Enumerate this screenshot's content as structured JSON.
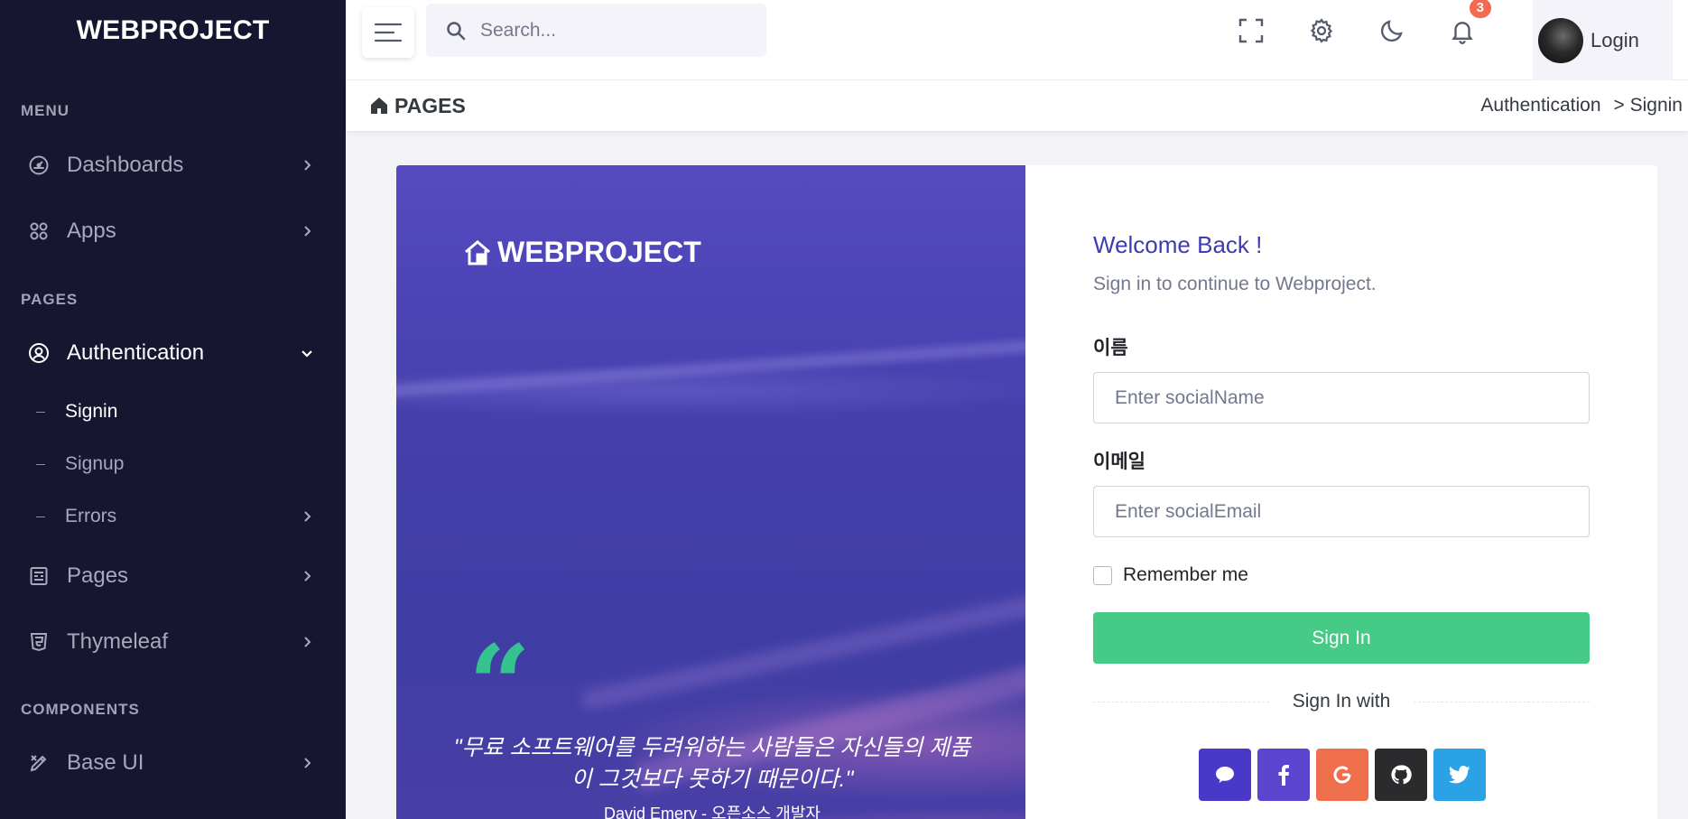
{
  "brand": "WEBPROJECT",
  "sidebar": {
    "menu_title": "MENU",
    "pages_title": "PAGES",
    "components_title": "COMPONENTS",
    "items": {
      "dashboards": "Dashboards",
      "apps": "Apps",
      "authentication": "Authentication",
      "signin": "Signin",
      "signup": "Signup",
      "errors": "Errors",
      "pages": "Pages",
      "thymeleaf": "Thymeleaf",
      "base_ui": "Base UI"
    }
  },
  "topbar": {
    "search_placeholder": "Search...",
    "notification_count": "3",
    "user_label": "Login"
  },
  "titlebar": {
    "title": "PAGES",
    "breadcrumb_parent": "Authentication",
    "breadcrumb_current": "> Signin"
  },
  "hero": {
    "brand": "WEBPROJECT",
    "quote_mark": "“",
    "quote": "\"무료 소프트웨어를 두려워하는 사람들은 자신들의 제품이 그것보다 못하기 때문이다.\"",
    "author": "David Emery - 오픈소스 개발자"
  },
  "form": {
    "welcome": "Welcome Back !",
    "subtitle": "Sign in to continue to Webproject.",
    "name_label": "이름",
    "name_placeholder": "Enter socialName",
    "email_label": "이메일",
    "email_placeholder": "Enter socialEmail",
    "remember": "Remember me",
    "submit": "Sign In",
    "sign_in_with": "Sign In with"
  },
  "social_buttons": [
    {
      "name": "kakao-talk",
      "color": "#4a39c8",
      "icon": "chat-bubble-icon"
    },
    {
      "name": "facebook",
      "color": "#5b45cf",
      "icon": "facebook-icon"
    },
    {
      "name": "google",
      "color": "#ef6e4b",
      "icon": "google-icon"
    },
    {
      "name": "github",
      "color": "#2b2b2e",
      "icon": "github-icon"
    },
    {
      "name": "twitter",
      "color": "#2ba1e6",
      "icon": "twitter-icon"
    }
  ],
  "colors": {
    "sidebar_bg": "#161630",
    "accent": "#3d3cb0",
    "success": "#45cb85",
    "badge": "#f46a4e"
  }
}
